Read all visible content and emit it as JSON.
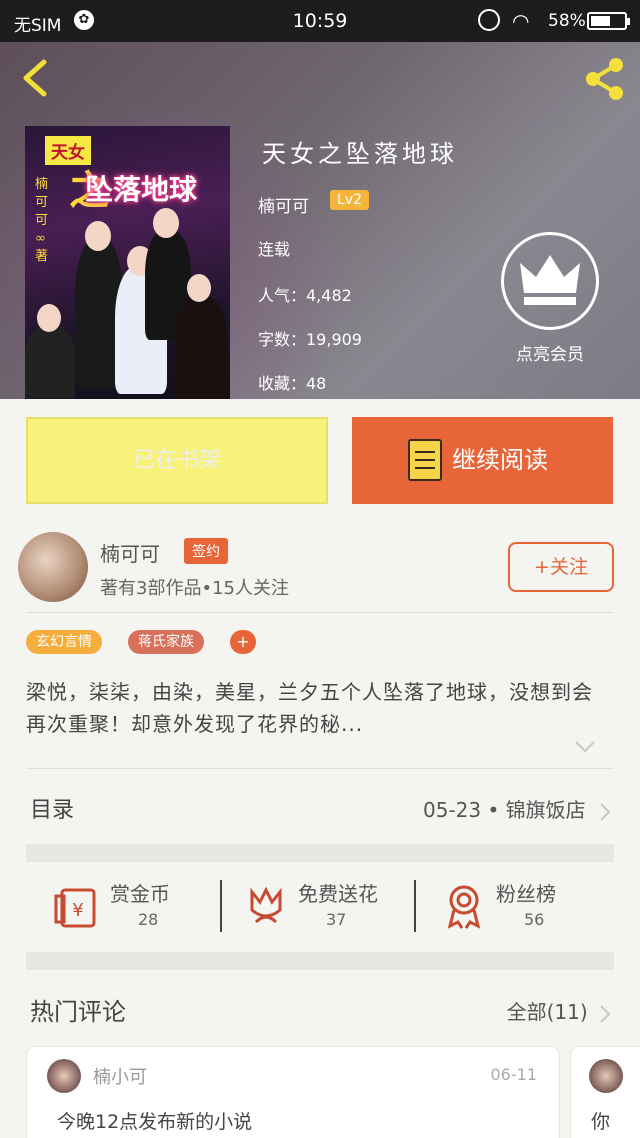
{
  "status_bar": {
    "sim": "无SIM",
    "time": "10:59",
    "battery": "58%",
    "battery_level": 0.58
  },
  "book": {
    "title": "天女之坠落地球",
    "author": "楠可可",
    "level": "Lv2",
    "status": "连载",
    "popularity_label": "人气：4,482",
    "word_count_label": "字数：19,909",
    "favorites_label": "收藏：48",
    "vip_label": "点亮会员"
  },
  "cover": {
    "tag": "天女",
    "zhi": "之",
    "main_title": "坠落地球",
    "vertical_text": "楠可可∞著"
  },
  "actions": {
    "shelf_label": "已在书架",
    "read_label": "继续阅读"
  },
  "author_row": {
    "name": "楠可可",
    "sign_badge": "签约",
    "meta": "著有3部作品•15人关注",
    "follow_label": "+关注"
  },
  "tags": [
    "玄幻言情",
    "蒋氏家族"
  ],
  "tag_add": "+",
  "synopsis": "梁悦，柒柒，由染，美星，兰夕五个人坠落了地球，没想到会再次重聚！却意外发现了花界的秘...",
  "catalog": {
    "label": "目录",
    "latest": "05-23 • 锦旗饭店"
  },
  "gifts": [
    {
      "label": "赏金币",
      "count": "28",
      "icon": "red-envelope-icon"
    },
    {
      "label": "免费送花",
      "count": "37",
      "icon": "flower-icon"
    },
    {
      "label": "粉丝榜",
      "count": "56",
      "icon": "medal-icon"
    }
  ],
  "comments": {
    "title": "热门评论",
    "all_label": "全部(11)",
    "items": [
      {
        "user": "楠小可",
        "date": "06-11",
        "text": "今晚12点发布新的小说"
      },
      {
        "text": "你"
      }
    ]
  },
  "colors": {
    "accent": "#e8653a",
    "shelf": "#f8f27a",
    "back": "#f3df3a"
  }
}
